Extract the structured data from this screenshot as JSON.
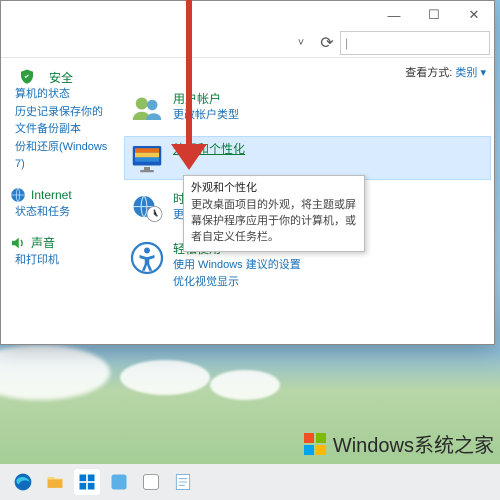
{
  "titlebar": {
    "min": "—",
    "max": "☐",
    "close": "✕"
  },
  "toolbar": {
    "dropdown": "˅",
    "refresh": "⟳",
    "search_placeholder": ""
  },
  "viewbar": {
    "label": "查看方式:",
    "mode": "类别 ▾"
  },
  "sidebar": {
    "groups": [
      {
        "icon": "shield",
        "title": "安全",
        "subs": [
          "算机的状态",
          "历史记录保存你的文件备份副本",
          "份和还原(Windows 7)"
        ]
      },
      {
        "icon": "net",
        "title": "Internet",
        "subs": [
          "状态和任务"
        ]
      },
      {
        "icon": "speaker",
        "title": "声音",
        "subs": [
          "和打印机"
        ]
      }
    ]
  },
  "main": {
    "categories": [
      {
        "id": "users",
        "title": "用户帐户",
        "subs": [
          "更改帐户类型"
        ]
      },
      {
        "id": "appearance",
        "title": "外观和个性化",
        "subs": [],
        "highlight": true
      },
      {
        "id": "clock",
        "title": "时钟和区域",
        "subs": [
          "更改日期、时间或数字格式"
        ]
      },
      {
        "id": "ease",
        "title": "轻松使用",
        "subs": [
          "使用 Windows 建议的设置",
          "优化视觉显示"
        ]
      }
    ]
  },
  "tooltip": {
    "title": "外观和个性化",
    "body": "更改桌面项目的外观，将主题或屏幕保护程序应用于你的计算机，或者自定义任务栏。"
  },
  "watermark": {
    "text": "Windows系统之家"
  }
}
